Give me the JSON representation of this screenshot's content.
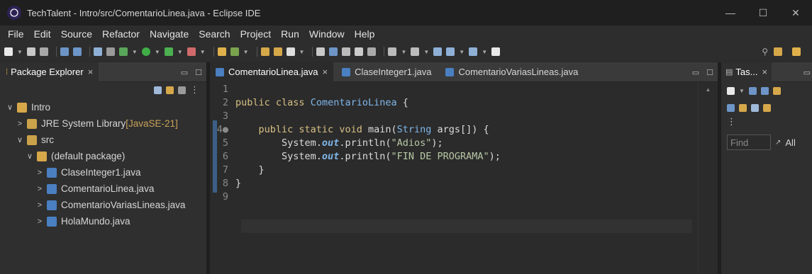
{
  "window": {
    "title": "TechTalent - Intro/src/ComentarioLinea.java - Eclipse IDE",
    "minimize": "—",
    "maximize": "☐",
    "close": "✕"
  },
  "menu": [
    "File",
    "Edit",
    "Source",
    "Refactor",
    "Navigate",
    "Search",
    "Project",
    "Run",
    "Window",
    "Help"
  ],
  "package_explorer": {
    "tab_label": "Package Explorer",
    "tab_close": "×",
    "tree": [
      {
        "toggle": "∨",
        "label": "Intro",
        "extra": "",
        "indent": 0,
        "icon": "project-icon"
      },
      {
        "toggle": ">",
        "label": "JRE System Library ",
        "extra": "[JavaSE-21]",
        "indent": 1,
        "icon": "library-icon"
      },
      {
        "toggle": "∨",
        "label": "src",
        "extra": "",
        "indent": 1,
        "icon": "source-folder-icon"
      },
      {
        "toggle": "∨",
        "label": "(default package)",
        "extra": "",
        "indent": 2,
        "icon": "package-icon"
      },
      {
        "toggle": ">",
        "label": "ClaseInteger1.java",
        "extra": "",
        "indent": 3,
        "icon": "java-file-warning-icon"
      },
      {
        "toggle": ">",
        "label": "ComentarioLinea.java",
        "extra": "",
        "indent": 3,
        "icon": "java-file-icon"
      },
      {
        "toggle": ">",
        "label": "ComentarioVariasLineas.java",
        "extra": "",
        "indent": 3,
        "icon": "java-file-icon"
      },
      {
        "toggle": ">",
        "label": "HolaMundo.java",
        "extra": "",
        "indent": 3,
        "icon": "java-file-icon"
      }
    ]
  },
  "editor": {
    "tabs": [
      {
        "label": "ComentarioLinea.java",
        "close": "×",
        "active": true
      },
      {
        "label": "ClaseInteger1.java",
        "close": "",
        "active": false
      },
      {
        "label": "ComentarioVariasLineas.java",
        "close": "",
        "active": false
      }
    ],
    "lines": [
      {
        "n": "1",
        "tokens": []
      },
      {
        "n": "2",
        "tokens": [
          [
            "kw",
            "public "
          ],
          [
            "kw",
            "class "
          ],
          [
            "cls",
            "ComentarioLinea"
          ],
          [
            "cl",
            " {"
          ]
        ]
      },
      {
        "n": "3",
        "tokens": []
      },
      {
        "n": "4●",
        "tokens": [
          [
            "cl",
            "    "
          ],
          [
            "kw",
            "public "
          ],
          [
            "kw",
            "static "
          ],
          [
            "kw",
            "void "
          ],
          [
            "cl",
            "main("
          ],
          [
            "cls",
            "String"
          ],
          [
            "cl",
            " args[]) {"
          ]
        ]
      },
      {
        "n": "5",
        "tokens": [
          [
            "cl",
            "        System."
          ],
          [
            "fld",
            "out"
          ],
          [
            "cl",
            ".println("
          ],
          [
            "str",
            "\"Adios\""
          ],
          [
            "cl",
            ");"
          ]
        ]
      },
      {
        "n": "6",
        "tokens": [
          [
            "cl",
            "        System."
          ],
          [
            "fld",
            "out"
          ],
          [
            "cl",
            ".println("
          ],
          [
            "str",
            "\"FIN DE PROGRAMA\""
          ],
          [
            "cl",
            ");"
          ]
        ]
      },
      {
        "n": "7",
        "tokens": [
          [
            "cl",
            "    }"
          ]
        ]
      },
      {
        "n": "8",
        "tokens": [
          [
            "cl",
            "}"
          ]
        ]
      },
      {
        "n": "9",
        "tokens": []
      }
    ]
  },
  "task_panel": {
    "tab_label": "Tas...",
    "tab_close": "×",
    "find_placeholder": "Find",
    "all_label": "All"
  },
  "colors": {
    "keyword": "#d8c084",
    "type": "#7fb6e8",
    "string": "#b7c8a5"
  }
}
